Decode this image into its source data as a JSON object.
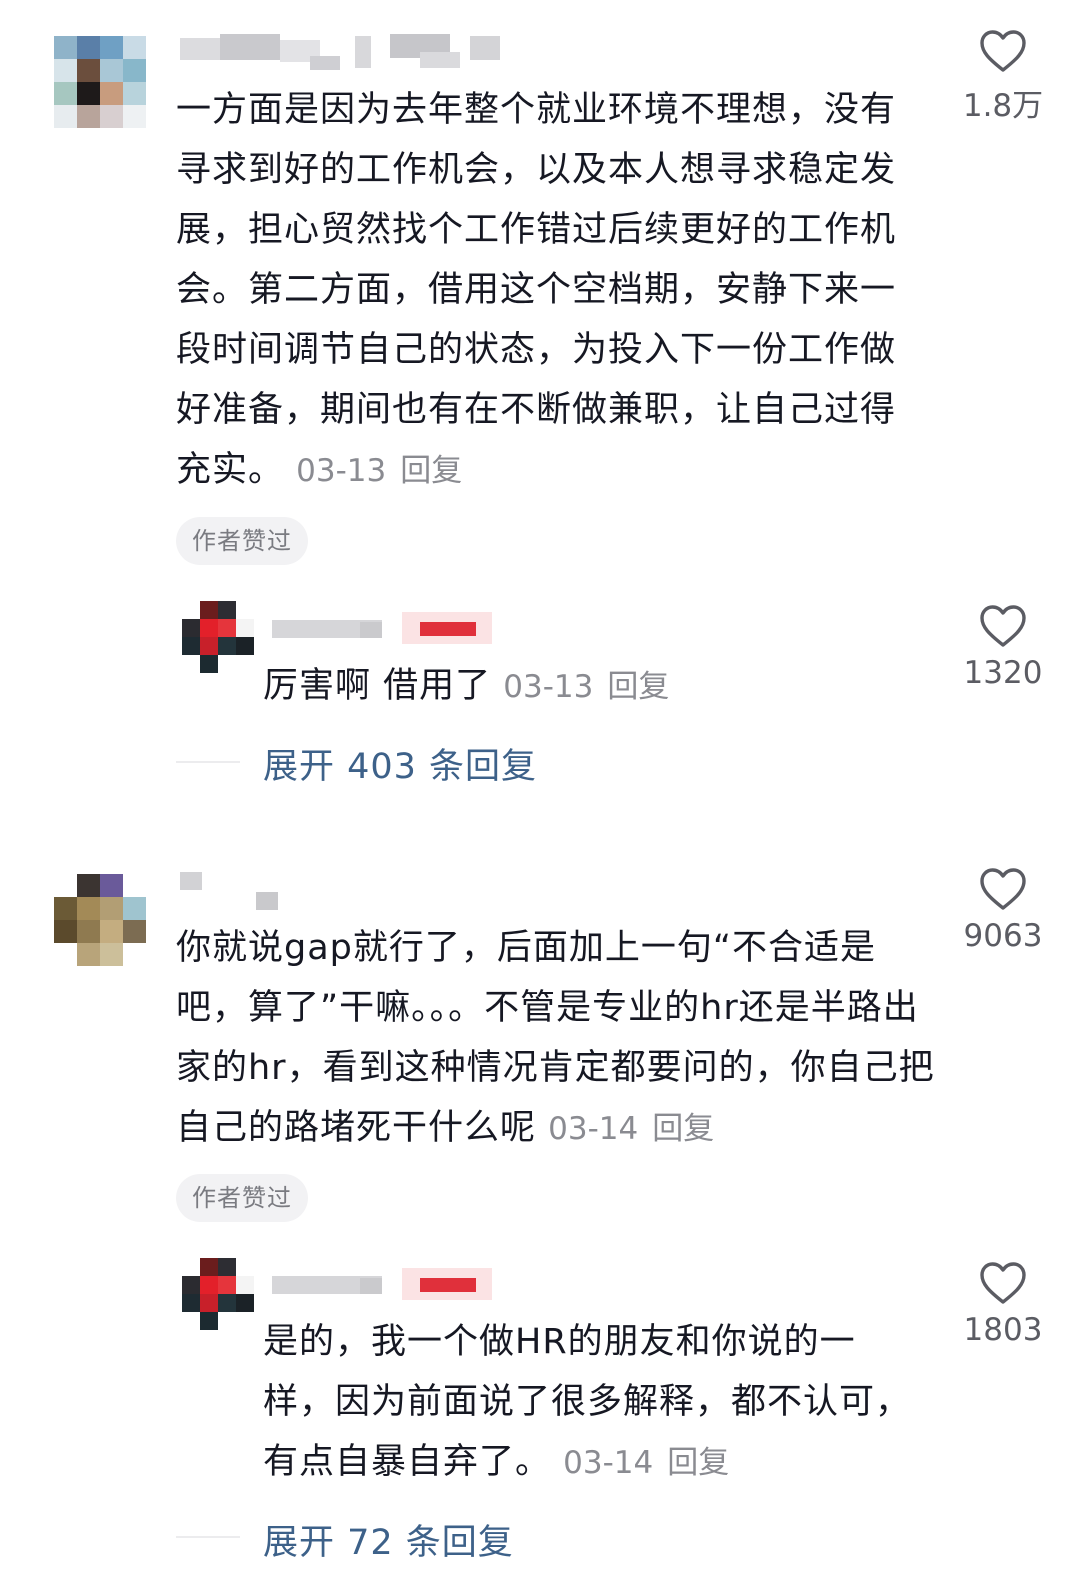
{
  "comments": [
    {
      "body": "一方面是因为去年整个就业环境不理想，没有寻求到好的工作机会，以及本人想寻求稳定发展，担心贸然找个工作错过后续更好的工作机会。第二方面，借用这个空档期，安静下来一段时间调节自己的状态，为投入下一份工作做好准备，期间也有在不断做兼职，让自己过得充实。",
      "date": "03-13",
      "reply_label": "回复",
      "author_liked": "作者赞过",
      "likes": "1.8万",
      "reply": {
        "body": "厉害啊 借用了",
        "date": "03-13",
        "reply_label": "回复",
        "likes": "1320"
      },
      "expand_label": "展开 403 条回复"
    },
    {
      "body": "你就说gap就行了，后面加上一句“不合适是吧，算了”干嘛。。。不管是专业的hr还是半路出家的hr，看到这种情况肯定都要问的，你自己把自己的路堵死干什么呢",
      "date": "03-14",
      "reply_label": "回复",
      "author_liked": "作者赞过",
      "likes": "9063",
      "reply": {
        "body": "是的，我一个做HR的朋友和你说的一样，因为前面说了很多解释，都不认可，有点自暴自弃了。",
        "date": "03-14",
        "reply_label": "回复",
        "likes": "1803"
      },
      "expand_label": "展开 72 条回复"
    }
  ],
  "icons": {
    "like": "heart-outline-icon"
  },
  "colors": {
    "link": "#3d6189",
    "meta": "#8a8b91",
    "text": "#161823"
  }
}
